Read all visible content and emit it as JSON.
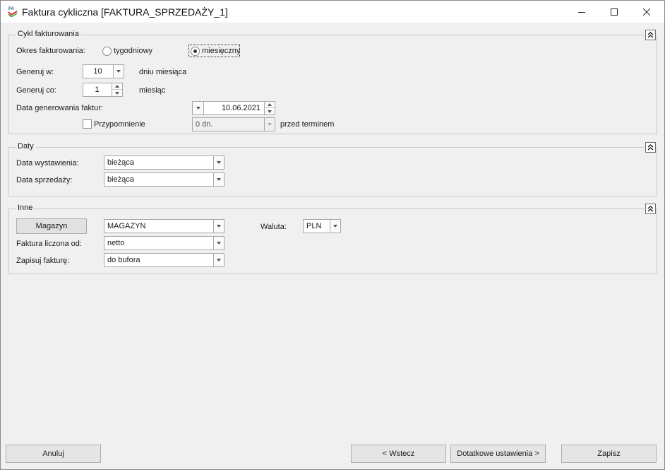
{
  "window": {
    "title": "Faktura cykliczna [FAKTURA_SPRZEDAŻY_1]",
    "icon_text": "FA",
    "minimize_icon": "minimize-icon",
    "maximize_icon": "maximize-icon",
    "close_icon": "close-icon"
  },
  "cykl": {
    "title": "Cykl fakturowania",
    "okres_label": "Okres fakturowania:",
    "radio_tygodniowy": "tygodniowy",
    "radio_miesieczny": "miesięczny",
    "selected": "miesięczny",
    "generuj_w_label": "Generuj w:",
    "generuj_w_value": "10",
    "generuj_w_suffix": "dniu miesiąca",
    "generuj_co_label": "Generuj co:",
    "generuj_co_value": "1",
    "generuj_co_suffix": "miesiąc",
    "data_gen_label": "Data generowania faktur:",
    "data_gen_value": "10.06.2021",
    "przypomnienie_label": "Przypomnienie",
    "przypomnienie_checked": false,
    "przypomnienie_value": "0 dn.",
    "przypomnienie_suffix": "przed terminem"
  },
  "daty": {
    "title": "Daty",
    "wystawienia_label": "Data wystawienia:",
    "wystawienia_value": "bieżąca",
    "sprzedazy_label": "Data sprzedaży:",
    "sprzedazy_value": "bieżąca"
  },
  "inne": {
    "title": "Inne",
    "magazyn_button": "Magazyn",
    "magazyn_value": "MAGAZYN",
    "waluta_label": "Waluta:",
    "waluta_value": "PLN",
    "liczona_label": "Faktura liczona od:",
    "liczona_value": "netto",
    "zapisuj_label": "Zapisuj fakturę:",
    "zapisuj_value": "do bufora"
  },
  "footer": {
    "anuluj": "Anuluj",
    "wstecz": "< Wstecz",
    "dodatkowe": "Dotatkowe ustawienia >",
    "zapisz": "Zapisz"
  }
}
